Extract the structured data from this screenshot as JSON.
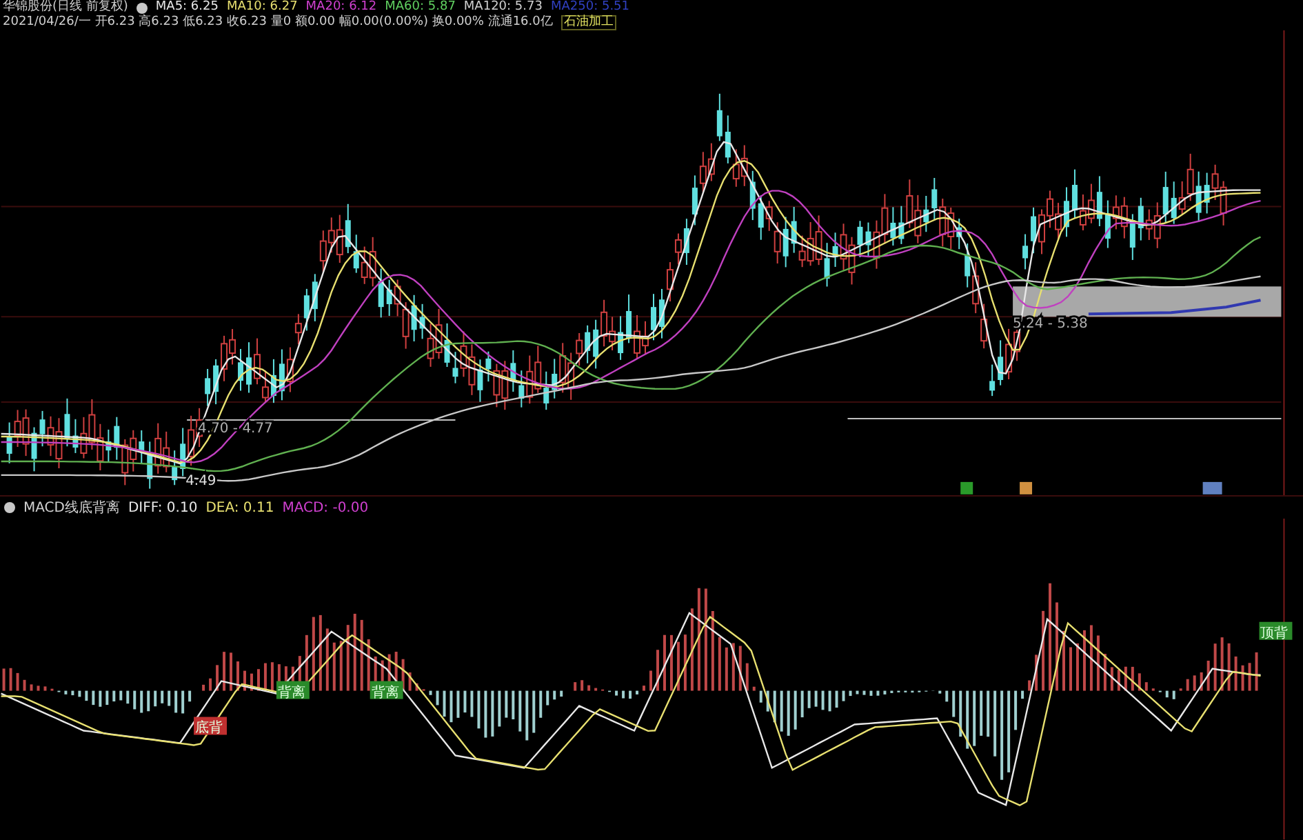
{
  "header": {
    "title": "华锦股份(日线 前复权)",
    "ma_readings": [
      {
        "label": "MA5: 6.25",
        "color": "#e8e8e8"
      },
      {
        "label": "MA10: 6.27",
        "color": "#e8e070"
      },
      {
        "label": "MA20: 6.12",
        "color": "#d040d0"
      },
      {
        "label": "MA60: 5.87",
        "color": "#60d060"
      },
      {
        "label": "MA120: 5.73",
        "color": "#d0d0d0"
      },
      {
        "label": "MA250: 5.51",
        "color": "#3040c0"
      }
    ],
    "quote": "2021/04/26/一 开6.23 高6.23 低6.23 收6.23 量0 额0.00 幅0.00(0.00%) 换0.00% 流通16.0亿",
    "sector": "石油加工"
  },
  "price_labels": [
    {
      "text": "4.70 - 4.77",
      "kind": "range"
    },
    {
      "text": "4.49",
      "kind": "low"
    },
    {
      "text": "5.24 - 5.38",
      "kind": "range"
    }
  ],
  "macd": {
    "title": "MACD线底背离",
    "readings": [
      {
        "label": "DIFF: 0.10",
        "color": "#e8e8e8"
      },
      {
        "label": "DEA: 0.11",
        "color": "#e8e070"
      },
      {
        "label": "MACD: -0.00",
        "color": "#d040d0"
      }
    ],
    "labels": [
      {
        "text": "底背",
        "kind": "red"
      },
      {
        "text": "背离",
        "kind": "green"
      },
      {
        "text": "背离",
        "kind": "green"
      },
      {
        "text": "顶背",
        "kind": "green"
      }
    ]
  }
}
